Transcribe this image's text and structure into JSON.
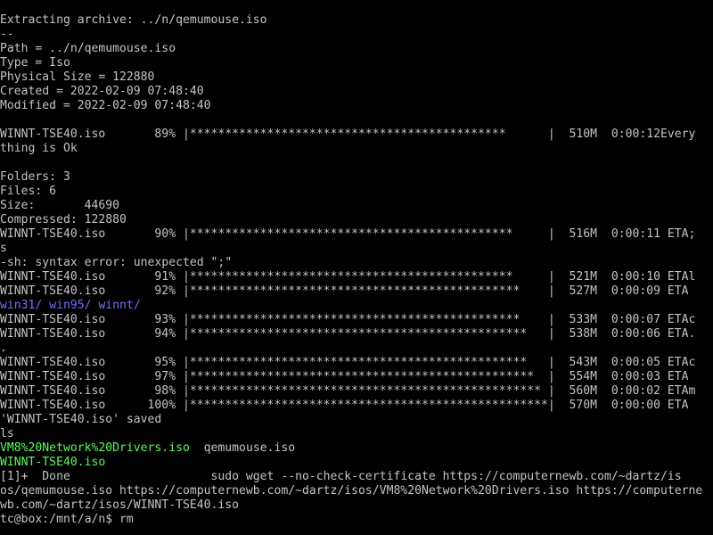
{
  "colors": {
    "background": "#000000",
    "text": "#c4c4c4",
    "green_file": "#5cf75c",
    "blue_dir": "#7070ff"
  },
  "terminal": {
    "lines": [
      "Extracting archive: ../n/qemumouse.iso",
      "--",
      "Path = ../n/qemumouse.iso",
      "Type = Iso",
      "Physical Size = 122880",
      "Created = 2022-02-09 07:48:40",
      "Modified = 2022-02-09 07:48:40",
      "",
      "WINNT-TSE40.iso       89% |*********************************************      |  510M  0:00:12Every",
      "thing is Ok",
      "",
      "Folders: 3",
      "Files: 6",
      "Size:       44690",
      "Compressed: 122880",
      "WINNT-TSE40.iso       90% |**********************************************     |  516M  0:00:11 ETA;",
      "s",
      "-sh: syntax error: unexpected \";\"",
      "WINNT-TSE40.iso       91% |**********************************************     |  521M  0:00:10 ETAl",
      "WINNT-TSE40.iso       92% |***********************************************    |  527M  0:00:09 ETA",
      "",
      "WINNT-TSE40.iso       93% |***********************************************    |  533M  0:00:07 ETAc",
      "WINNT-TSE40.iso       94% |************************************************   |  538M  0:00:06 ETA.",
      ".",
      "WINNT-TSE40.iso       95% |************************************************   |  543M  0:00:05 ETAc",
      "WINNT-TSE40.iso       97% |*************************************************  |  554M  0:00:03 ETA",
      "WINNT-TSE40.iso       98% |************************************************** |  560M  0:00:02 ETAm",
      "WINNT-TSE40.iso      100% |***************************************************|  570M  0:00:00 ETA",
      "'WINNT-TSE40.iso' saved",
      "ls",
      "",
      "",
      "[1]+  Done                    sudo wget --no-check-certificate https://computernewb.com/~dartz/is",
      "os/qemumouse.iso https://computernewb.com/~dartz/isos/VM8%20Network%20Drivers.iso https://computerne",
      "wb.com/~dartz/isos/WINNT-TSE40.iso",
      "tc@box:/mnt/a/n$ rm"
    ],
    "dir_listing": [
      "win31/",
      "win95/",
      "winnt/"
    ],
    "ls_output": {
      "file1": "VM8%20Network%20Drivers.iso",
      "file2": "qemumouse.iso",
      "file3": "WINNT-TSE40.iso"
    }
  }
}
